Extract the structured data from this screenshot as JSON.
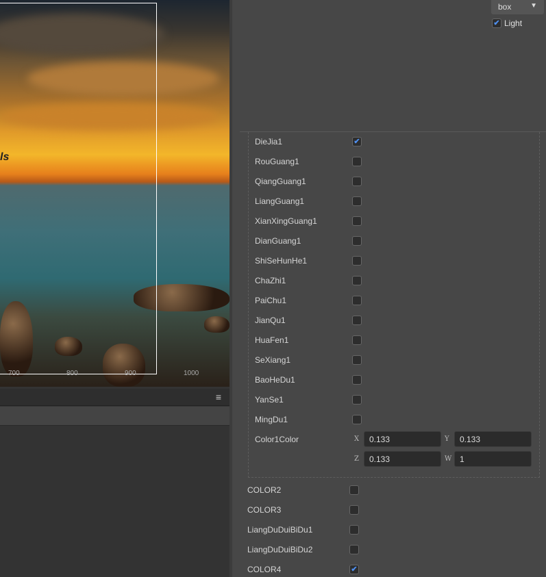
{
  "scene": {
    "overlay_text": "ls",
    "ruler_ticks": [
      "700",
      "800",
      "900",
      "1000"
    ]
  },
  "left_panel": {
    "menu_icon": "hamburger-icon"
  },
  "toolbar": {
    "dropdown_value": "box",
    "light_label": "Light",
    "light_checked": true
  },
  "group_items": [
    {
      "label": "DieJia1",
      "checked": true
    },
    {
      "label": "RouGuang1",
      "checked": false
    },
    {
      "label": "QiangGuang1",
      "checked": false
    },
    {
      "label": "LiangGuang1",
      "checked": false
    },
    {
      "label": "XianXingGuang1",
      "checked": false
    },
    {
      "label": "DianGuang1",
      "checked": false
    },
    {
      "label": "ShiSeHunHe1",
      "checked": false
    },
    {
      "label": "ChaZhi1",
      "checked": false
    },
    {
      "label": "PaiChu1",
      "checked": false
    },
    {
      "label": "JianQu1",
      "checked": false
    },
    {
      "label": "HuaFen1",
      "checked": false
    },
    {
      "label": "SeXiang1",
      "checked": false
    },
    {
      "label": "BaoHeDu1",
      "checked": false
    },
    {
      "label": "YanSe1",
      "checked": false
    },
    {
      "label": "MingDu1",
      "checked": false
    }
  ],
  "color1": {
    "label": "Color1Color",
    "x_label": "X",
    "x": "0.133",
    "y_label": "Y",
    "y": "0.133",
    "z_label": "Z",
    "z": "0.133",
    "w_label": "W",
    "w": "1"
  },
  "outer_items": [
    {
      "label": "COLOR2",
      "checked": false
    },
    {
      "label": "COLOR3",
      "checked": false
    },
    {
      "label": "LiangDuDuiBiDu1",
      "checked": false
    },
    {
      "label": "LiangDuDuiBiDu2",
      "checked": false
    },
    {
      "label": "COLOR4",
      "checked": true
    }
  ],
  "colors": {
    "accent": "#4f8ff0",
    "panel": "#474747"
  }
}
